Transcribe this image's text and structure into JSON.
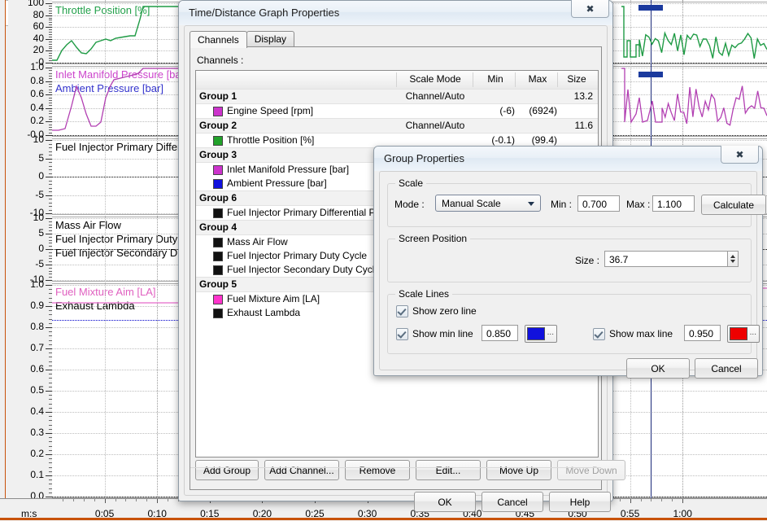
{
  "chart": {
    "x_axis": {
      "unit_label": "m:s",
      "ticks": [
        "0:05",
        "0:10",
        "0:15",
        "0:20",
        "0:25",
        "0:30",
        "0:35",
        "0:40",
        "0:45",
        "0:50",
        "0:55",
        "1:00"
      ]
    },
    "panes": [
      {
        "name": "throttle",
        "labels": [
          {
            "text": "Throttle Position [%]",
            "color": "#22a04a"
          }
        ],
        "ticks": [
          "100",
          "80",
          "60",
          "40",
          "20",
          "-0"
        ]
      },
      {
        "name": "pressure",
        "labels": [
          {
            "text": "Inlet Manifold Pressure [bar]",
            "color": "#cc44cc"
          },
          {
            "text": "Ambient Pressure [bar]",
            "color": "#3333cc"
          }
        ],
        "ticks": [
          "1.0",
          "0.8",
          "0.6",
          "0.4",
          "0.2",
          "-0.0"
        ]
      },
      {
        "name": "injector-diff-pressure",
        "labels": [
          {
            "text": "Fuel Injector Primary Differe",
            "color": "#000000"
          }
        ],
        "ticks": [
          "10",
          "5",
          "0",
          "-5",
          "-10"
        ]
      },
      {
        "name": "mass-air-flow",
        "labels": [
          {
            "text": "Mass Air Flow",
            "color": "#000000"
          },
          {
            "text": "Fuel Injector Primary Duty C",
            "color": "#000000"
          },
          {
            "text": "Fuel Injector Secondary Du",
            "color": "#000000"
          }
        ],
        "ticks": [
          "10",
          "5",
          "0",
          "-5",
          "-10"
        ]
      },
      {
        "name": "lambda",
        "labels": [
          {
            "text": "Fuel Mixture Aim [LA]",
            "color": "#e060c0"
          },
          {
            "text": "Exhaust Lambda",
            "color": "#000000"
          }
        ],
        "ticks": [
          "1.0",
          "0.9",
          "0.8",
          "0.7",
          "0.6",
          "0.5",
          "0.4",
          "0.3",
          "0.2",
          "0.1",
          "0.0"
        ]
      }
    ]
  },
  "graph_dialog": {
    "title": "Time/Distance Graph Properties",
    "close_icon": "close-icon",
    "tabs": [
      {
        "label": "Channels",
        "active": true
      },
      {
        "label": "Display",
        "active": false
      }
    ],
    "channels_label": "Channels :",
    "columns": [
      "Scale Mode",
      "Min",
      "Max",
      "Size"
    ],
    "rows": [
      {
        "type": "group",
        "name": "Group 1",
        "mode": "Channel/Auto",
        "min": "",
        "max": "",
        "size": "13.2"
      },
      {
        "type": "channel",
        "name": "Engine Speed [rpm]",
        "color": "#cc33cc",
        "mode": "",
        "min": "(-6)",
        "max": "(6924)",
        "size": ""
      },
      {
        "type": "group",
        "name": "Group 2",
        "mode": "Channel/Auto",
        "min": "",
        "max": "",
        "size": "11.6"
      },
      {
        "type": "channel",
        "name": "Throttle Position [%]",
        "color": "#22a22a",
        "mode": "",
        "min": "(-0.1)",
        "max": "(99.4)",
        "size": ""
      },
      {
        "type": "group",
        "name": "Group 3",
        "mode": "",
        "min": "",
        "max": "",
        "size": ""
      },
      {
        "type": "channel",
        "name": "Inlet Manifold Pressure [bar]",
        "color": "#cc33cc",
        "mode": "",
        "min": "",
        "max": "",
        "size": ""
      },
      {
        "type": "channel",
        "name": "Ambient Pressure [bar]",
        "color": "#1111dd",
        "mode": "",
        "min": "",
        "max": "",
        "size": ""
      },
      {
        "type": "group",
        "name": "Group 6",
        "mode": "",
        "min": "",
        "max": "",
        "size": ""
      },
      {
        "type": "channel",
        "name": "Fuel Injector Primary Differential Pressure",
        "color": "#111111",
        "mode": "",
        "min": "",
        "max": "",
        "size": ""
      },
      {
        "type": "group",
        "name": "Group 4",
        "mode": "",
        "min": "",
        "max": "",
        "size": ""
      },
      {
        "type": "channel",
        "name": "Mass Air Flow",
        "color": "#111111",
        "mode": "",
        "min": "",
        "max": "",
        "size": ""
      },
      {
        "type": "channel",
        "name": "Fuel Injector Primary Duty Cycle",
        "color": "#111111",
        "mode": "",
        "min": "",
        "max": "",
        "size": ""
      },
      {
        "type": "channel",
        "name": "Fuel Injector Secondary Duty Cycle",
        "color": "#111111",
        "mode": "",
        "min": "",
        "max": "",
        "size": ""
      },
      {
        "type": "group",
        "name": "Group 5",
        "mode": "",
        "min": "",
        "max": "",
        "size": ""
      },
      {
        "type": "channel",
        "name": "Fuel Mixture Aim [LA]",
        "color": "#ff33cc",
        "mode": "",
        "min": "",
        "max": "",
        "size": ""
      },
      {
        "type": "channel",
        "name": "Exhaust Lambda",
        "color": "#111111",
        "mode": "",
        "min": "",
        "max": "",
        "size": ""
      }
    ],
    "list_buttons": [
      {
        "label": "Add Group",
        "enabled": true
      },
      {
        "label": "Add Channel...",
        "enabled": true
      },
      {
        "label": "Remove",
        "enabled": true
      },
      {
        "label": "Edit...",
        "enabled": true
      },
      {
        "label": "Move Up",
        "enabled": true
      },
      {
        "label": "Move Down",
        "enabled": false
      }
    ],
    "footer_buttons": [
      {
        "label": "OK"
      },
      {
        "label": "Cancel"
      },
      {
        "label": "Help"
      }
    ]
  },
  "group_dialog": {
    "title": "Group Properties",
    "close_icon": "close-icon",
    "scale": {
      "legend": "Scale",
      "mode_label": "Mode :",
      "mode_value": "Manual Scale",
      "min_label": "Min :",
      "min_value": "0.700",
      "max_label": "Max :",
      "max_value": "1.100",
      "calculate_label": "Calculate"
    },
    "screen_position": {
      "legend": "Screen Position",
      "size_label": "Size :",
      "size_value": "36.7"
    },
    "scale_lines": {
      "legend": "Scale Lines",
      "zero_label": "Show zero line",
      "min_label": "Show min line",
      "min_value": "0.850",
      "min_color": "#1111dd",
      "max_label": "Show max line",
      "max_value": "0.950",
      "max_color": "#ee0000",
      "ellipsis": "..."
    },
    "footer_buttons": [
      {
        "label": "OK"
      },
      {
        "label": "Cancel"
      }
    ]
  }
}
